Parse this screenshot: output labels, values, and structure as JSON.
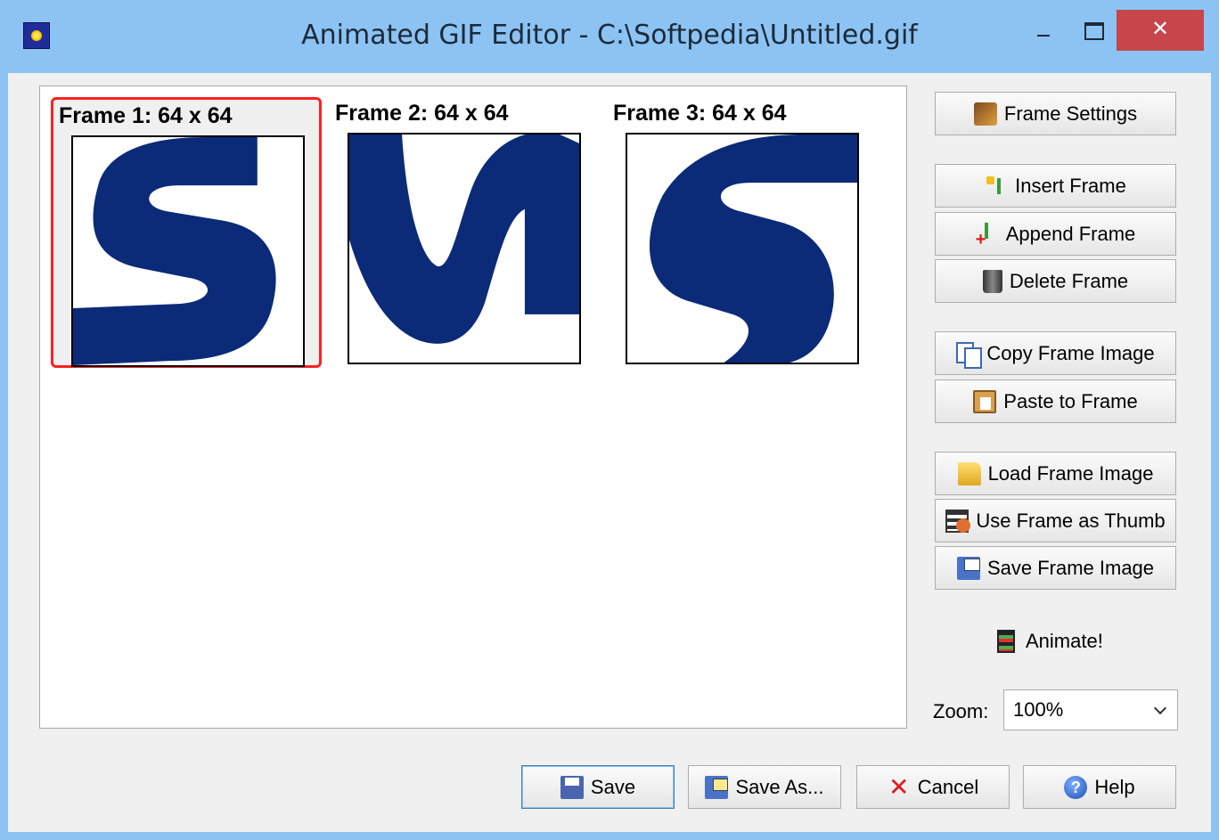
{
  "window": {
    "title": "Animated GIF Editor - C:\\Softpedia\\Untitled.gif",
    "close_glyph": "✕"
  },
  "frames": [
    {
      "label": "Frame 1: 64 x 64",
      "selected": true
    },
    {
      "label": "Frame 2: 64 x 64",
      "selected": false
    },
    {
      "label": "Frame 3: 64 x 64",
      "selected": false
    }
  ],
  "side_buttons": {
    "frame_settings": "Frame Settings",
    "insert_frame": "Insert Frame",
    "append_frame": "Append Frame",
    "delete_frame": "Delete Frame",
    "copy_frame_image": "Copy Frame Image",
    "paste_to_frame": "Paste to Frame",
    "load_frame_image": "Load Frame Image",
    "use_frame_as_thumb": "Use Frame as Thumb",
    "save_frame_image": "Save Frame Image"
  },
  "animate": {
    "label": "Animate!"
  },
  "zoom": {
    "label": "Zoom:",
    "value": "100%"
  },
  "bottom_buttons": {
    "save": "Save",
    "save_as": "Save As...",
    "cancel": "Cancel",
    "help": "Help"
  },
  "icons": {
    "frame_settings": "frame-settings-icon",
    "insert": "insert-frame-icon",
    "append": "append-frame-icon",
    "delete": "trash-icon",
    "copy": "copy-icon",
    "paste": "paste-icon",
    "load": "folder-open-icon",
    "thumb": "film-thumb-icon",
    "save_frame": "save-frame-icon",
    "animate": "film-strip-icon",
    "save": "floppy-icon",
    "save_as": "save-as-icon",
    "cancel": "cancel-x-icon",
    "help": "help-icon"
  },
  "colors": {
    "accent_frame_border": "#ff2020",
    "letter_blue": "#0b2a78",
    "title_bar": "#8cc3f3",
    "close_button": "#c7464a"
  }
}
